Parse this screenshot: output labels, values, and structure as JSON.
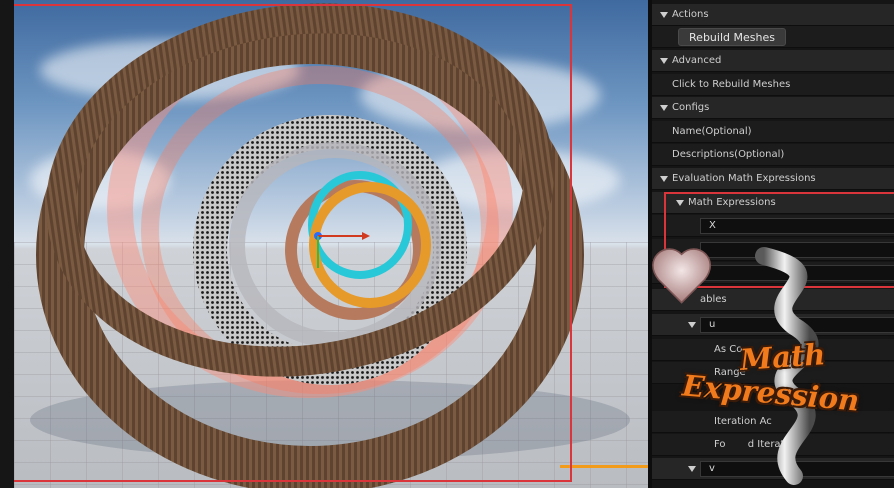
{
  "details": {
    "actions": {
      "title": "Actions",
      "rebuild_button": "Rebuild Meshes"
    },
    "advanced": {
      "title": "Advanced",
      "click_to_rebuild": "Click to Rebuild Meshes"
    },
    "configs": {
      "title": "Configs",
      "name": "Name(Optional)",
      "descriptions": "Descriptions(Optional)",
      "eval_title": "Evaluation Math Expressions",
      "math_title": "Math Expressions",
      "x_value": "X",
      "variables_label": "ables",
      "var_u": {
        "name": "u",
        "as_const": "As Co",
        "range": "Range",
        "iteration_accuracy": "Iteration Ac",
        "for_iteration": "Fo       d Iteration"
      },
      "var_v": {
        "name": "v"
      }
    }
  },
  "logo": {
    "line1": "Math",
    "line2": "Expression"
  },
  "colors": {
    "selection": "#d9353b",
    "accent": "#f29a1a",
    "logo_text": "#f07a1c"
  }
}
